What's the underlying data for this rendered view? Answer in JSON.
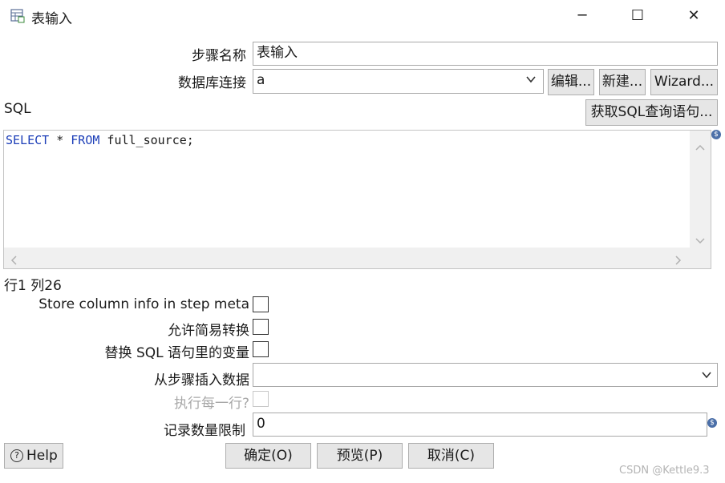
{
  "window": {
    "title": "表输入",
    "minimize_icon": "─",
    "maximize_icon": "☐",
    "close_icon": "✕"
  },
  "form": {
    "step_name_label": "步骤名称",
    "step_name_value": "表输入",
    "db_conn_label": "数据库连接",
    "db_conn_value": "a",
    "edit_button": "编辑...",
    "new_button": "新建...",
    "wizard_button": "Wizard...",
    "sql_label": "SQL",
    "get_sql_button": "获取SQL查询语句...",
    "sql_keyword_select": "SELECT",
    "sql_star": " * ",
    "sql_keyword_from": "FROM",
    "sql_rest": " full_source;",
    "cursor_pos": "行1 列26",
    "store_column_label": "Store column info in step meta",
    "lazy_conv_label": "允许简易转换",
    "replace_vars_label": "替换 SQL 语句里的变量",
    "insert_from_label": "从步骤插入数据",
    "insert_from_value": "",
    "execute_each_label": "执行每一行?",
    "limit_label": "记录数量限制",
    "limit_value": "0"
  },
  "footer": {
    "help_button": "Help",
    "ok_button": "确定(O)",
    "preview_button": "预览(P)",
    "cancel_button": "取消(C)",
    "watermark": "CSDN @Kettle9.3"
  },
  "icons": {
    "dollar": "$",
    "chevron_down": "⌄",
    "scroll_up": "︿",
    "scroll_down": "﹀",
    "scroll_left": "‹",
    "scroll_right": "›",
    "help": "?"
  }
}
